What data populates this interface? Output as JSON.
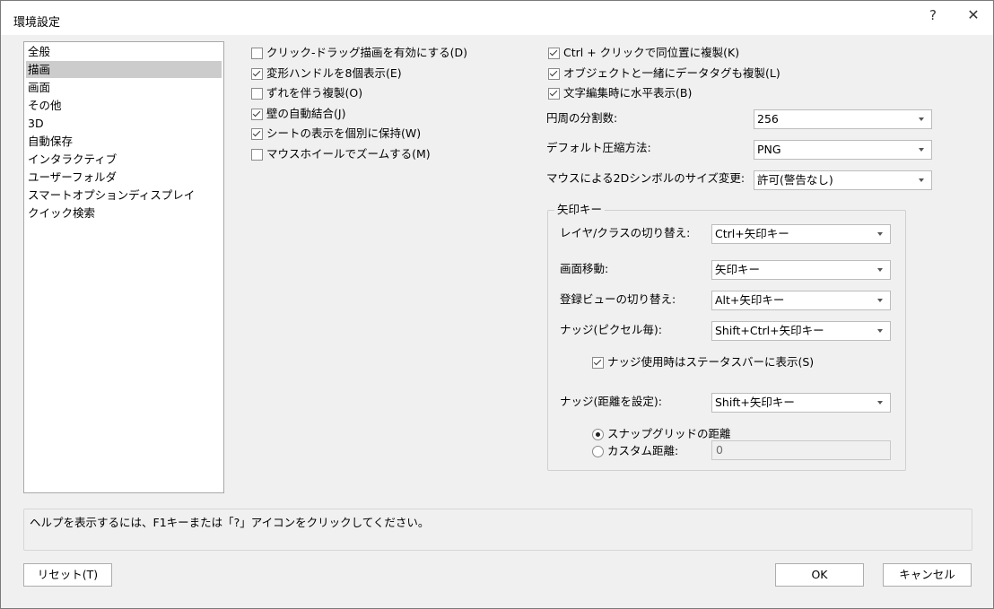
{
  "window": {
    "title": "環境設定",
    "help_glyph": "?",
    "close_glyph": "✕"
  },
  "categories": [
    "全般",
    "描画",
    "画面",
    "その他",
    "3D",
    "自動保存",
    "インタラクティブ",
    "ユーザーフォルダ",
    "スマートオプションディスプレイ",
    "クイック検索"
  ],
  "selected_category": "描画",
  "left_options": [
    {
      "label": "クリック-ドラッグ描画を有効にする(D)",
      "checked": false
    },
    {
      "label": "変形ハンドルを8個表示(E)",
      "checked": true
    },
    {
      "label": "ずれを伴う複製(O)",
      "checked": false
    },
    {
      "label": "壁の自動結合(J)",
      "checked": true
    },
    {
      "label": "シートの表示を個別に保持(W)",
      "checked": true
    },
    {
      "label": "マウスホイールでズームする(M)",
      "checked": false
    }
  ],
  "right_options": [
    {
      "label": "Ctrl + クリックで同位置に複製(K)",
      "checked": true
    },
    {
      "label": "オブジェクトと一緒にデータタグも複製(L)",
      "checked": true
    },
    {
      "label": "文字編集時に水平表示(B)",
      "checked": true
    }
  ],
  "settings": {
    "circle_div": {
      "label": "円周の分割数:",
      "value": "256"
    },
    "compression": {
      "label": "デフォルト圧縮方法:",
      "value": "PNG"
    },
    "symbol_resize": {
      "label": "マウスによる2Dシンボルのサイズ変更:",
      "value": "許可(警告なし)"
    }
  },
  "arrow_keys": {
    "legend": "矢印キー",
    "layer_class": {
      "label": "レイヤ/クラスの切り替え:",
      "value": "Ctrl+矢印キー"
    },
    "pan": {
      "label": "画面移動:",
      "value": "矢印キー"
    },
    "saved_view": {
      "label": "登録ビューの切り替え:",
      "value": "Alt+矢印キー"
    },
    "nudge_pixel": {
      "label": "ナッジ(ピクセル毎):",
      "value": "Shift+Ctrl+矢印キー"
    },
    "nudge_statusbar": {
      "label": "ナッジ使用時はステータスバーに表示(S)",
      "checked": true
    },
    "nudge_distance": {
      "label": "ナッジ(距離を設定):",
      "value": "Shift+矢印キー"
    },
    "snap_grid": {
      "label": "スナップグリッドの距離",
      "selected": true
    },
    "custom_distance": {
      "label": "カスタム距離:",
      "selected": false,
      "value": "0"
    }
  },
  "help_text": "ヘルプを表示するには、F1キーまたは「?」アイコンをクリックしてください。",
  "buttons": {
    "reset": "リセット(T)",
    "ok": "OK",
    "cancel": "キャンセル"
  }
}
